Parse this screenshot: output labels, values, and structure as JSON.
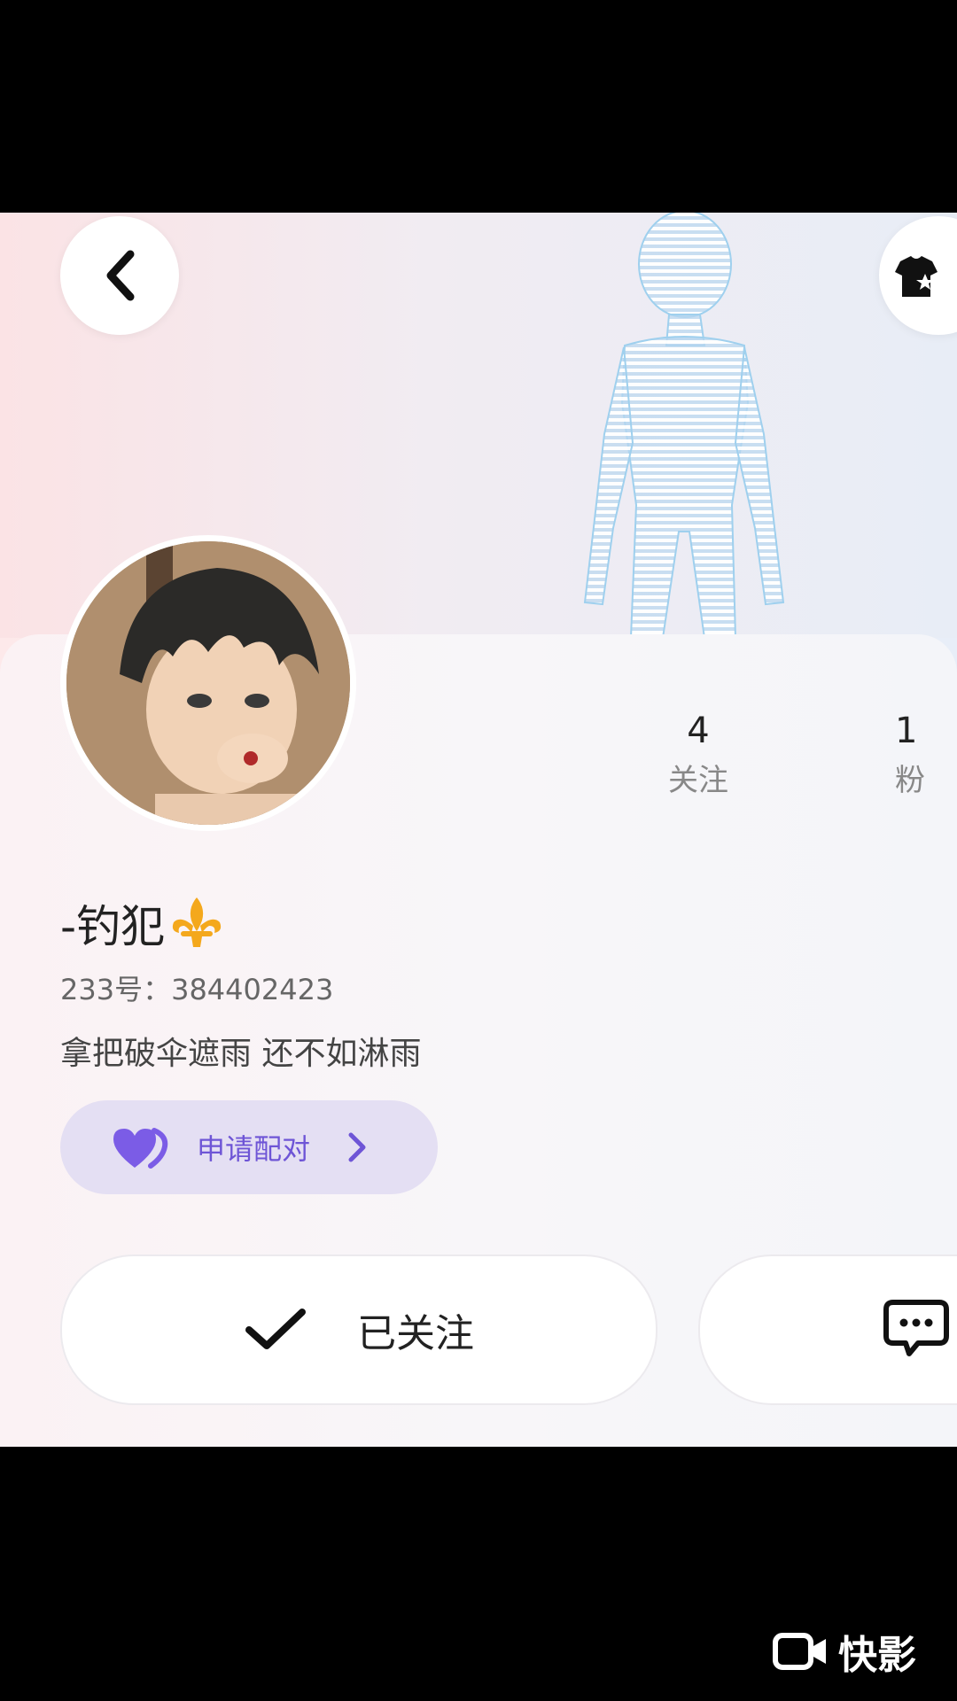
{
  "header": {
    "back_icon": "chevron-left-icon",
    "outfit_icon": "tshirt-star-icon"
  },
  "profile": {
    "username": "-钓犯",
    "badge_icon": "fleur-de-lis-icon",
    "uid": "233号：384402423",
    "bio": "拿把破伞遮雨 还不如淋雨"
  },
  "stats": {
    "following": {
      "value": "4",
      "label": "关注"
    },
    "fans": {
      "value": "1",
      "label": "粉"
    }
  },
  "pair_button": {
    "label": "申请配对",
    "icon": "heart-icon"
  },
  "actions": {
    "follow_label": "已关注",
    "message_icon": "chat-bubble-icon"
  },
  "watermark": {
    "text": "快影"
  },
  "colors": {
    "accent": "#6e55d6",
    "pair_bg": "#e4dff3",
    "badge_gold": "#f4a81c"
  }
}
